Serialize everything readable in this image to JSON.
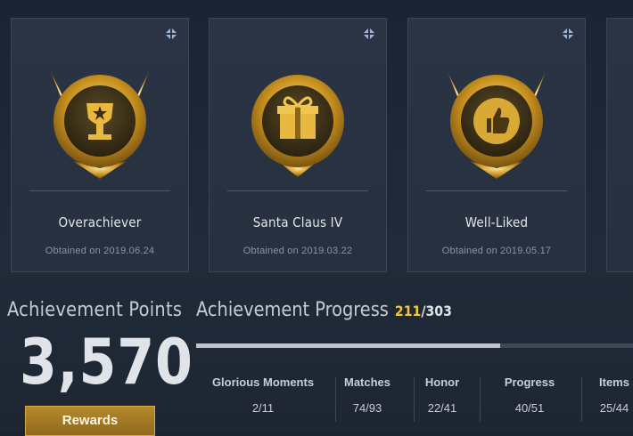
{
  "achievements": [
    {
      "name": "Overachiever",
      "date": "Obtained on 2019.06.24",
      "icon": "trophy-badge-icon"
    },
    {
      "name": "Santa Claus IV",
      "date": "Obtained on 2019.03.22",
      "icon": "gift-badge-icon"
    },
    {
      "name": "Well-Liked",
      "date": "Obtained on 2019.05.17",
      "icon": "thumbs-up-badge-icon"
    }
  ],
  "points": {
    "title": "Achievement Points",
    "value": "3,570",
    "rewards_label": "Rewards"
  },
  "progress": {
    "title": "Achievement Progress",
    "current": "211",
    "total": "/303",
    "fraction": 0.696
  },
  "categories": [
    {
      "label": "Glorious Moments",
      "value": "2/11"
    },
    {
      "label": "Matches",
      "value": "74/93"
    },
    {
      "label": "Honor",
      "value": "22/41"
    },
    {
      "label": "Progress",
      "value": "40/51"
    },
    {
      "label": "Items",
      "value": "25/44"
    }
  ],
  "colors": {
    "gold": "#f2c740",
    "bg": "#1c2433",
    "card": "#2a3444"
  }
}
